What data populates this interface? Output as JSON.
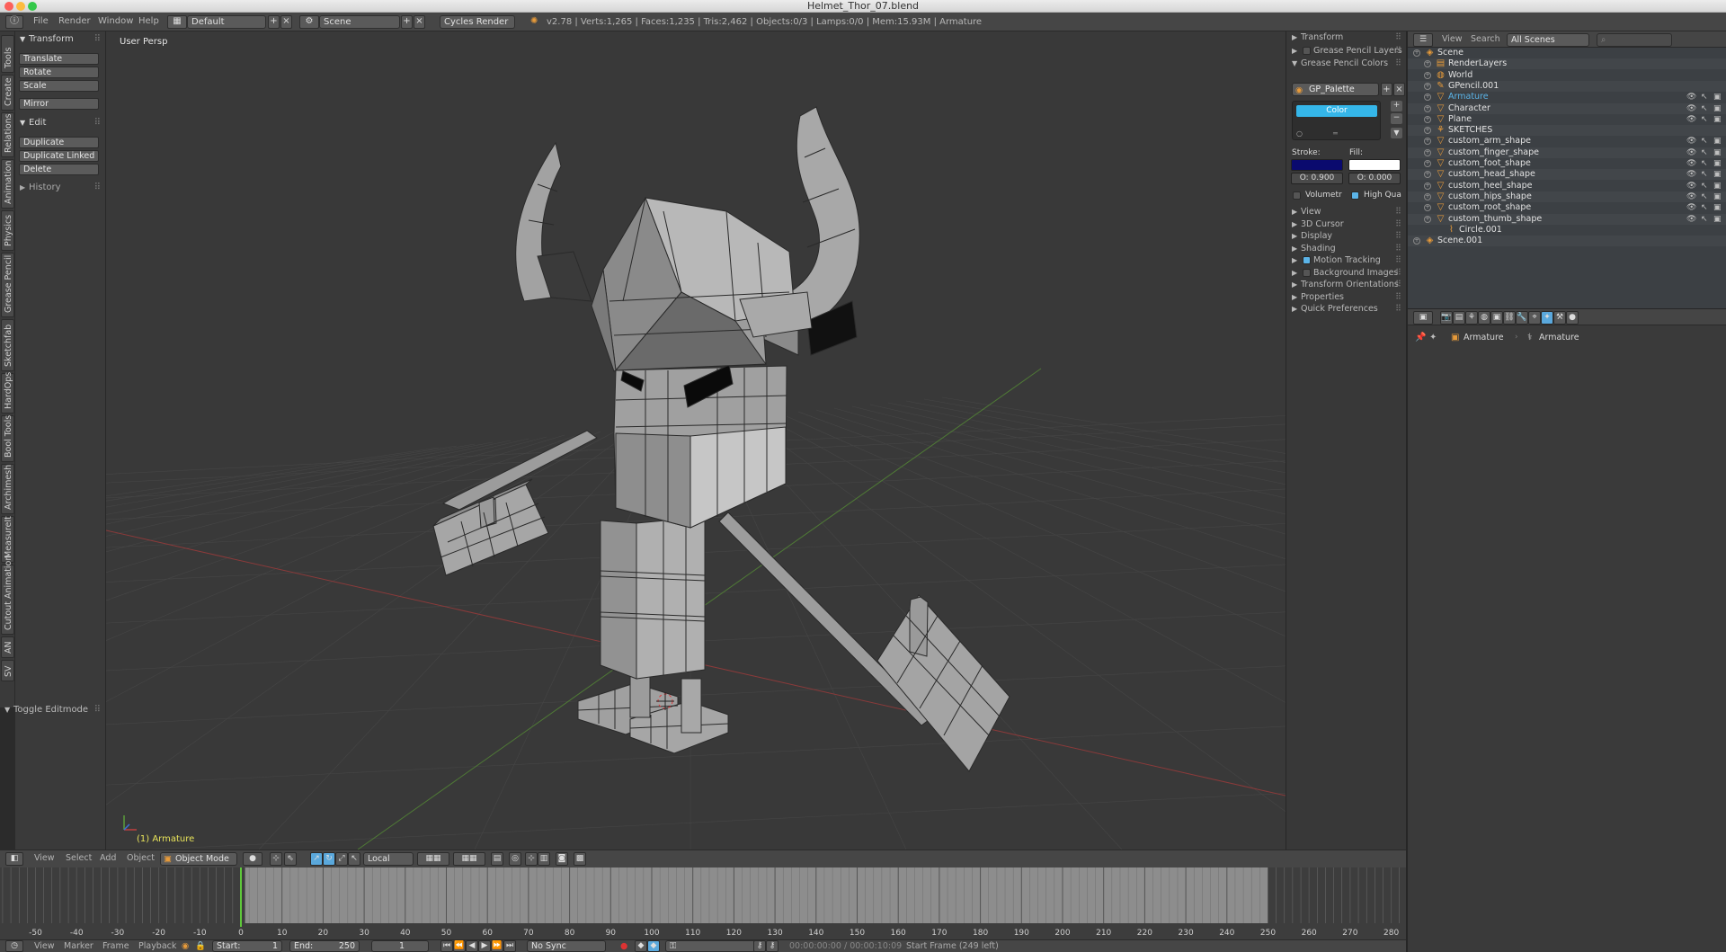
{
  "window": {
    "title": "Helmet_Thor_07.blend"
  },
  "info": {
    "menus": [
      "File",
      "Render",
      "Window",
      "Help"
    ],
    "screen": "Default",
    "scene": "Scene",
    "engine": "Cycles Render",
    "stats": "v2.78 | Verts:1,265 | Faces:1,235 | Tris:2,462 | Objects:0/3 | Lamps:0/0 | Mem:15.93M | Armature"
  },
  "vtabs": [
    "Tools",
    "Create",
    "Relations",
    "Animation",
    "Physics",
    "Grease Pencil",
    "Sketchfab",
    "HardOps",
    "Bool Tools",
    "Archimesh",
    "MeasureIt",
    "Cutout Animation",
    "AN",
    "SV"
  ],
  "toolshelf": {
    "transform_title": "Transform",
    "transform_buttons": [
      "Translate",
      "Rotate",
      "Scale"
    ],
    "mirror": "Mirror",
    "edit_title": "Edit",
    "edit_buttons": [
      "Duplicate",
      "Duplicate Linked",
      "Delete"
    ],
    "history_title": "History",
    "toggle_editmode": "Toggle Editmode"
  },
  "viewport": {
    "view_label": "User Persp",
    "object_label": "(1) Armature",
    "colors": {
      "bg": "#393939",
      "grid": "#464646",
      "x_axis": "#8a3a3a",
      "y_axis": "#4f7a36",
      "mesh": "#a8a8a8",
      "wire": "#2c2c2c"
    }
  },
  "npanel": {
    "transform": "Transform",
    "gp_layers": "Grease Pencil Layers",
    "gp_colors": "Grease Pencil Colors",
    "palette": "GP_Palette",
    "color_slot": "Color",
    "stroke_label": "Stroke:",
    "fill_label": "Fill:",
    "stroke_opacity": "O: 0.900",
    "fill_opacity": "O: 0.000",
    "volumetric": "Volumetr",
    "high_quality": "High Qua",
    "sections": [
      "View",
      "3D Cursor",
      "Display",
      "Shading",
      "Motion Tracking",
      "Background Images",
      "Transform Orientations",
      "Properties",
      "Quick Preferences"
    ],
    "colors": {
      "stroke": "#0a0a6e",
      "fill": "#ffffff",
      "accent": "#35b6e9"
    }
  },
  "outliner": {
    "menus": [
      "View",
      "Search"
    ],
    "display_mode": "All Scenes",
    "rows": [
      {
        "label": "Scene",
        "indent": 0,
        "icon": "◈"
      },
      {
        "label": "RenderLayers",
        "indent": 1,
        "icon": "▤"
      },
      {
        "label": "World",
        "indent": 1,
        "icon": "◍"
      },
      {
        "label": "GPencil.001",
        "indent": 1,
        "icon": "✎"
      },
      {
        "label": "Armature",
        "indent": 1,
        "icon": "▽",
        "active": true
      },
      {
        "label": "Character",
        "indent": 1,
        "icon": "▽"
      },
      {
        "label": "Plane",
        "indent": 1,
        "icon": "▽"
      },
      {
        "label": "SKETCHES",
        "indent": 1,
        "icon": "⚘"
      },
      {
        "label": "custom_arm_shape",
        "indent": 1,
        "icon": "▽"
      },
      {
        "label": "custom_finger_shape",
        "indent": 1,
        "icon": "▽"
      },
      {
        "label": "custom_foot_shape",
        "indent": 1,
        "icon": "▽"
      },
      {
        "label": "custom_head_shape",
        "indent": 1,
        "icon": "▽"
      },
      {
        "label": "custom_heel_shape",
        "indent": 1,
        "icon": "▽"
      },
      {
        "label": "custom_hips_shape",
        "indent": 1,
        "icon": "▽"
      },
      {
        "label": "custom_root_shape",
        "indent": 1,
        "icon": "▽"
      },
      {
        "label": "custom_thumb_shape",
        "indent": 1,
        "icon": "▽"
      },
      {
        "label": "Circle.001",
        "indent": 2,
        "icon": "⌇"
      },
      {
        "label": "Scene.001",
        "indent": 0,
        "icon": "◈"
      }
    ]
  },
  "properties": {
    "breadcrumb_1": "Armature",
    "breadcrumb_2": "Armature"
  },
  "viewport_header": {
    "menus": [
      "View",
      "Select",
      "Add",
      "Object"
    ],
    "mode": "Object Mode",
    "orientation": "Local"
  },
  "timeline": {
    "ticks": [
      "-50",
      "-40",
      "-30",
      "-20",
      "-10",
      "0",
      "10",
      "20",
      "30",
      "40",
      "50",
      "60",
      "70",
      "80",
      "90",
      "100",
      "110",
      "120",
      "130",
      "140",
      "150",
      "160",
      "170",
      "180",
      "190",
      "200",
      "210",
      "220",
      "230",
      "240",
      "250",
      "260",
      "270",
      "280"
    ],
    "menus": [
      "View",
      "Marker",
      "Frame",
      "Playback"
    ],
    "start_label": "Start:",
    "start": "1",
    "end_label": "End:",
    "end": "250",
    "current": "1",
    "sync": "No Sync",
    "time": "00:00:00:00 / 00:00:10:09",
    "start_frame_info": "Start Frame (249 left)"
  }
}
